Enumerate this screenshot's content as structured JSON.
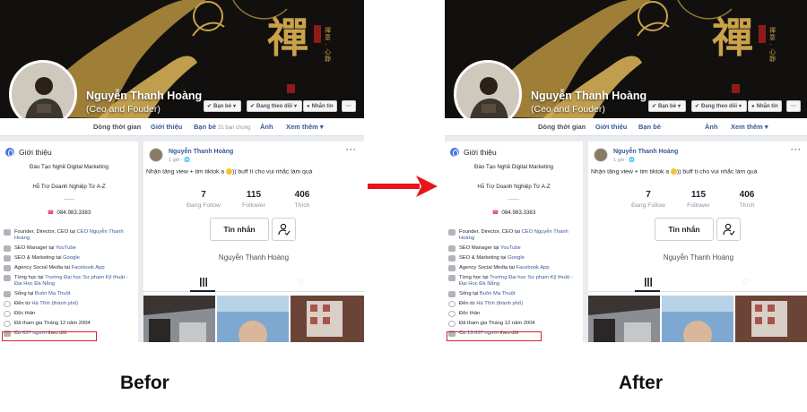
{
  "profile": {
    "name": "Nguyễn Thanh Hoàng",
    "subtitle": "(Ceo and Fouder)",
    "buttons": {
      "friends": "Bạn bè",
      "following": "Đang theo dõi",
      "message": "Nhắn tin",
      "more": "···"
    },
    "cover_calligraphy": "禪",
    "cover_small_text": "禪 意 · 心 靜"
  },
  "nav": {
    "timeline": "Dòng thời gian",
    "about": "Giới thiệu",
    "friends": "Bạn bè",
    "mutual": "31 bạn chung",
    "photos": "Ảnh",
    "more": "Xem thêm ▾"
  },
  "intro": {
    "title": "Giới thiệu",
    "line1": "Đào Tạo Nghề Digital Marketing",
    "line2": "Hỗ Trợ Doanh Nghiệp Từ A-Z",
    "separator": "——",
    "phone": "084.983.3383",
    "items": [
      {
        "text": "Founder, Director, CEO tại ",
        "link": "CEO Nguyễn Thanh Hoàng"
      },
      {
        "text": "SEO Manager tại ",
        "link": "YouTube"
      },
      {
        "text": "SEO & Marketing tại ",
        "link": "Google"
      },
      {
        "text": "Agency Social Media tại ",
        "link": "Facebook App"
      },
      {
        "text": "Từng học tại ",
        "link": "Trường Đại học Sư phạm Kỹ thuật - Đại Học Đà Nẵng"
      },
      {
        "text": "Sống tại ",
        "link": "Buôn Ma Thuột"
      },
      {
        "text": "Đến từ ",
        "link": "Hà Tĩnh (thành phố)"
      },
      {
        "text": "Độc thân",
        "link": ""
      },
      {
        "text": "Đã tham gia Tháng 12 năm 2004",
        "link": ""
      }
    ],
    "followers_before": {
      "prefix": "Có ",
      "link": "637 người",
      "suffix": " theo dõi"
    },
    "followers_after": {
      "prefix": "Có ",
      "link": "13.637 người",
      "suffix": " theo dõi"
    }
  },
  "post": {
    "author": "Nguyễn Thanh Hoàng",
    "time": "1 giờ · ",
    "more": "···",
    "text_before_emoji": "Nhận tăng view + tim tiktok a ",
    "text_after_emoji": ")) buff tí cho vui nhắc làm quá",
    "stats": [
      {
        "value": "7",
        "label": "Đang Follow"
      },
      {
        "value": "115",
        "label": "Follower"
      },
      {
        "value": "406",
        "label": "Thích"
      }
    ],
    "message_button": "Tin nhắn",
    "full_name": "Nguyễn Thanh Hoàng"
  },
  "captions": {
    "before": "Befor",
    "after": "After"
  },
  "colors": {
    "link": "#385898",
    "highlight_box": "#e0202a",
    "arrow": "#e8141b",
    "page_bg": "#e9ebee",
    "cover_gold": "#c9a24a"
  }
}
